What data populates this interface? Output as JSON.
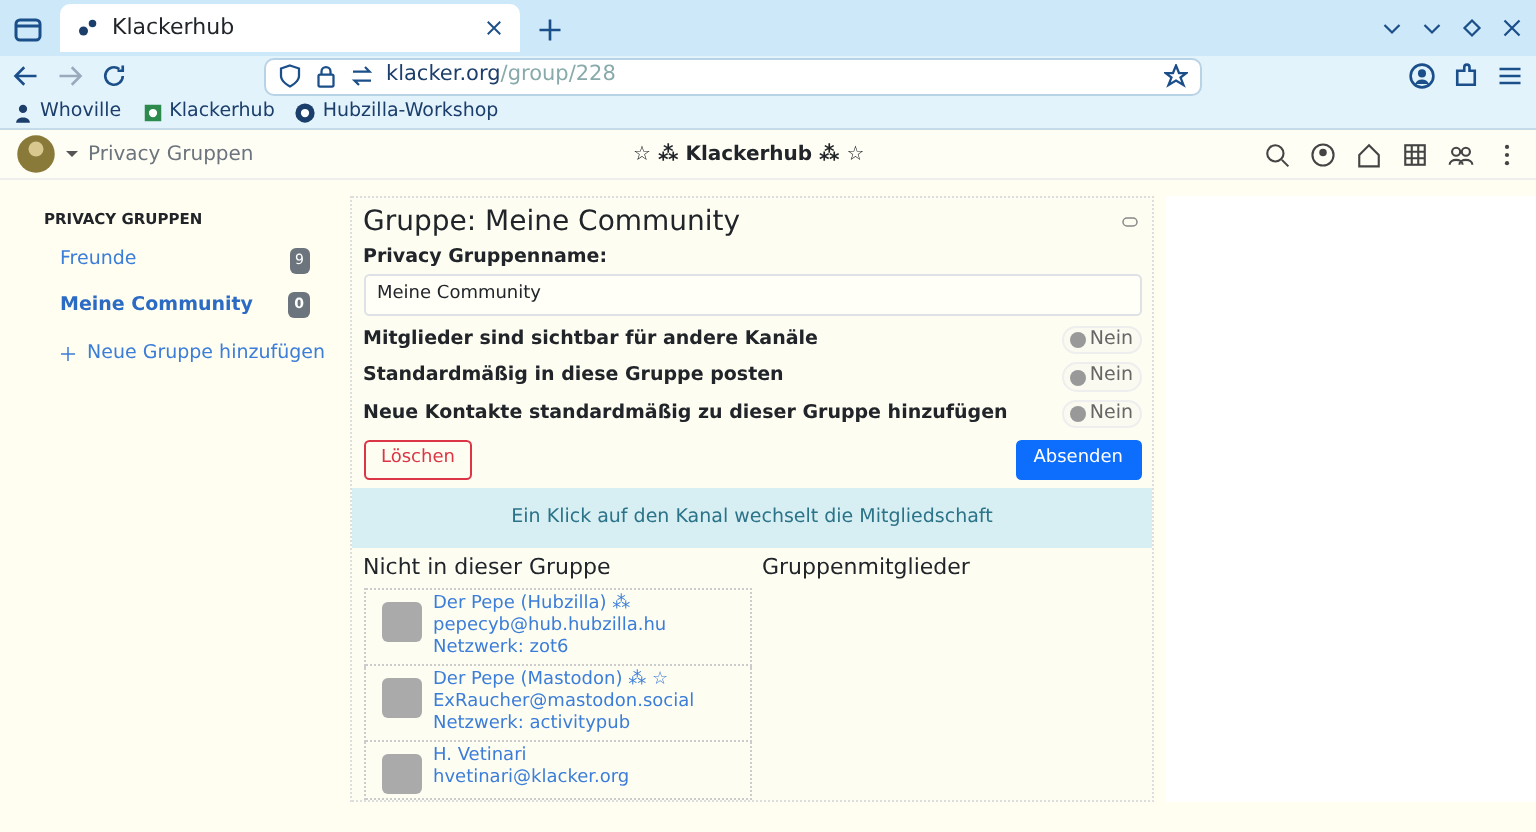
{
  "browser": {
    "tab_title": "Klackerhub",
    "url_host": "klacker.org",
    "url_path": "/group/228",
    "bookmarks": [
      "Whoville",
      "Klackerhub",
      "Hubzilla-Workshop"
    ]
  },
  "navbar": {
    "section": "Privacy Gruppen",
    "site_title": "☆ ⁂ Klackerhub ⁂ ☆"
  },
  "sidebar": {
    "heading": "PRIVACY GRUPPEN",
    "items": [
      {
        "label": "Freunde",
        "count": "9",
        "selected": false
      },
      {
        "label": "Meine Community",
        "count": "0",
        "selected": true
      }
    ],
    "add_link": "Neue Gruppe hinzufügen"
  },
  "group": {
    "title": "Gruppe: Meine Community",
    "name_label": "Privacy Gruppenname:",
    "name_value": "Meine Community",
    "settings": [
      {
        "label": "Mitglieder sind sichtbar für andere Kanäle",
        "value": "Nein",
        "on": false
      },
      {
        "label": "Standardmäßig in diese Gruppe posten",
        "value": "Nein",
        "on": false
      },
      {
        "label": "Neue Kontakte standardmäßig zu dieser Gruppe hinzufügen",
        "value": "Nein",
        "on": false
      }
    ],
    "delete_button": "Löschen",
    "submit_button": "Absenden",
    "hint": "Ein Klick auf den Kanal wechselt die Mitgliedschaft",
    "not_in_group": {
      "heading": "Nicht in dieser Gruppe",
      "contacts": [
        {
          "name": "Der Pepe (Hubzilla) ⁂",
          "address": "pepecyb@hub.hubzilla.hu",
          "network": "Netzwerk: zot6"
        },
        {
          "name": "Der Pepe (Mastodon) ⁂ ☆",
          "address": "ExRaucher@mastodon.social",
          "network": "Netzwerk: activitypub"
        },
        {
          "name": "H. Vetinari",
          "address": "hvetinari@klacker.org"
        }
      ]
    },
    "members": {
      "heading": "Gruppenmitglieder"
    }
  }
}
